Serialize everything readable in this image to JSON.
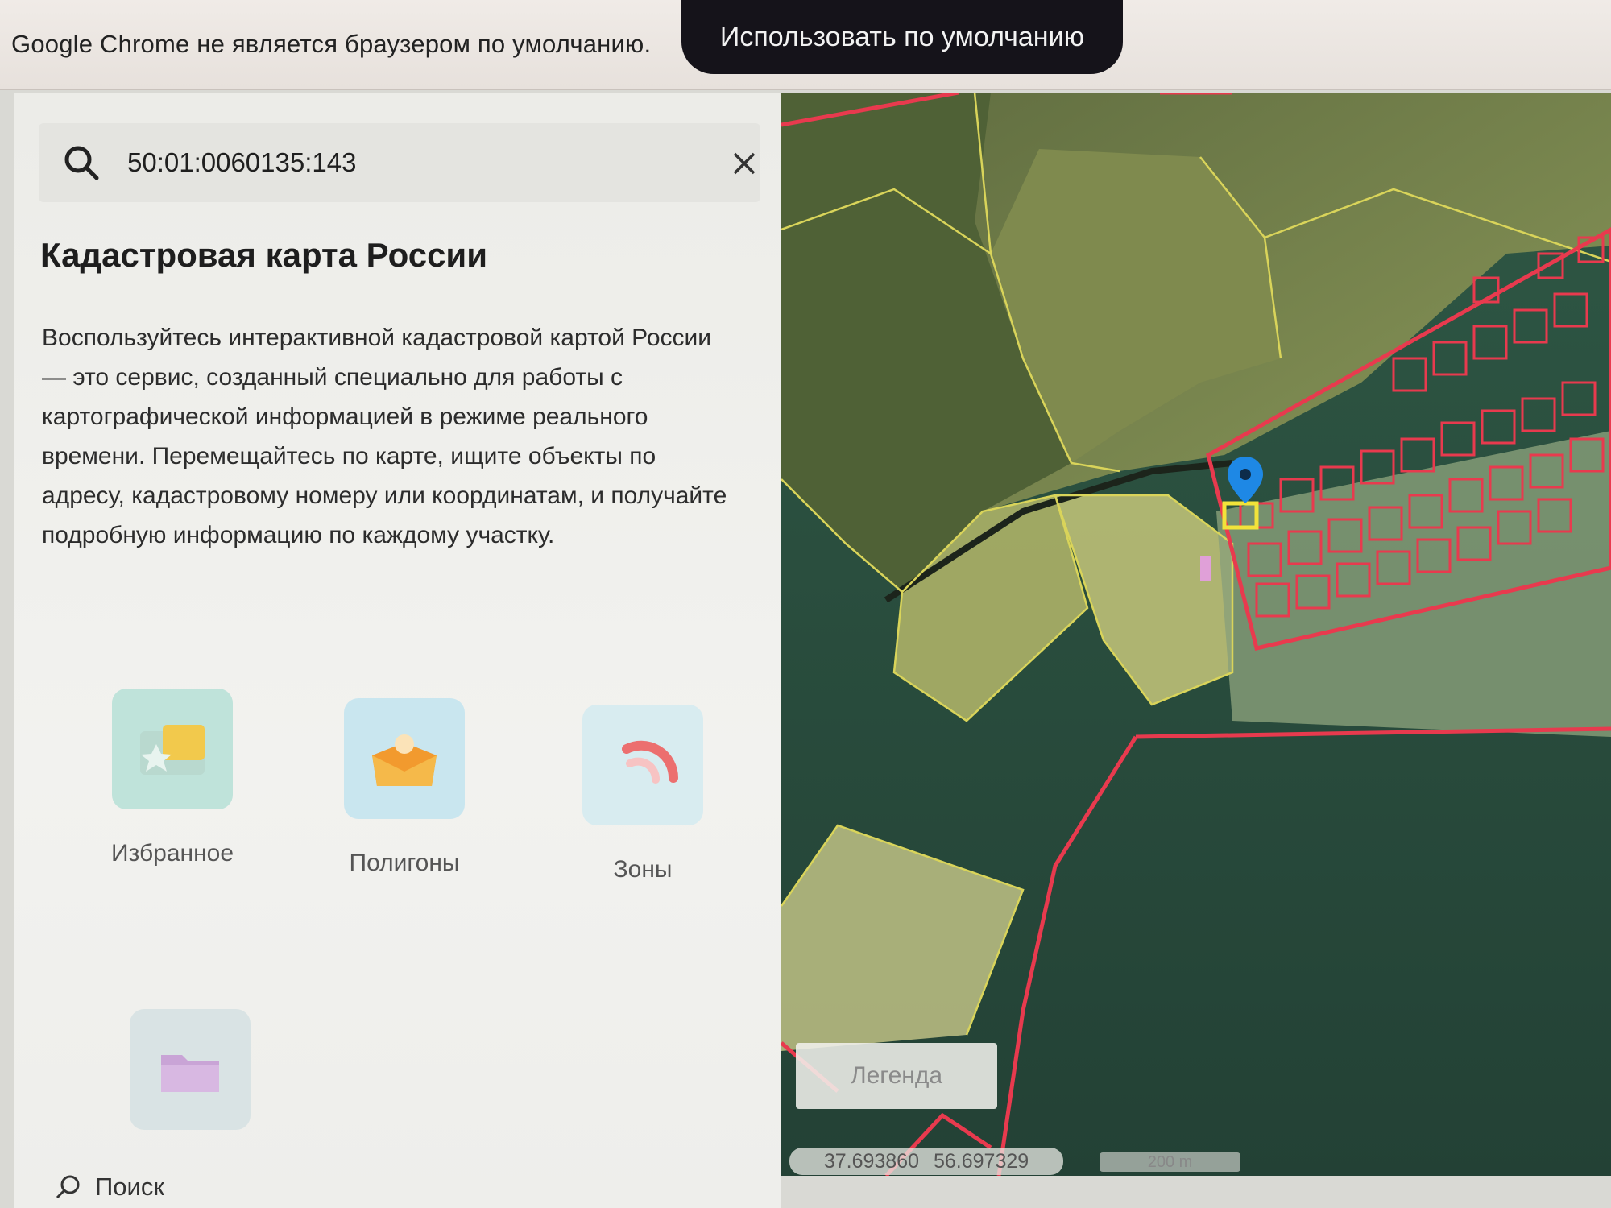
{
  "infobar": {
    "message": "Google Chrome не является браузером по умолчанию.",
    "button_label": "Использовать по умолчанию"
  },
  "search": {
    "value": "50:01:0060135:143"
  },
  "panel": {
    "title": "Кадастровая карта России",
    "description": "Воспользуйтесь интерактивной кадастровой картой России — это сервис, созданный специально для работы с картографической информацией в режиме реального времени. Перемещайтесь по карте, ищите объекты по адресу, кадастровому номеру или координатам, и получайте подробную информацию по каждому участку."
  },
  "features": [
    {
      "label": "Избранное",
      "icon": "star-folder-icon"
    },
    {
      "label": "Полигоны",
      "icon": "polygon-icon"
    },
    {
      "label": "Зоны",
      "icon": "zones-icon"
    },
    {
      "label": "",
      "icon": "folder-icon"
    }
  ],
  "map": {
    "legend_label": "Легенда",
    "lon": "37.693860",
    "lat": "56.697329",
    "scale_label": "200 m"
  },
  "taskbar": {
    "search_label": "Поиск"
  },
  "colors": {
    "parcel_outline": "#e83a4e",
    "selected_parcel": "#f2e33a",
    "field_fill": "#d9d57a",
    "marker": "#1e88e5"
  }
}
